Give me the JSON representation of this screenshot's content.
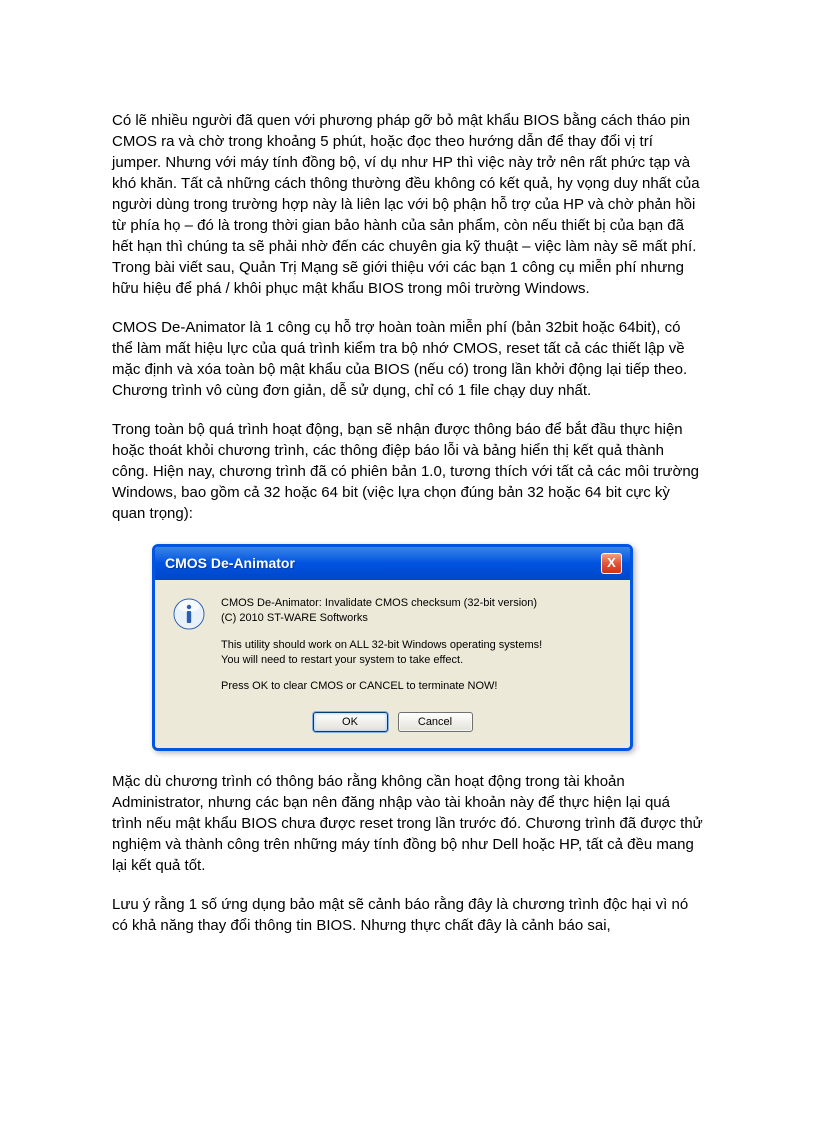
{
  "document": {
    "p1": "Có lẽ nhiều người đã quen với phương pháp gỡ bỏ mật khẩu BIOS bằng cách tháo pin CMOS ra và chờ trong khoảng 5 phút, hoặc đọc theo hướng dẫn để thay đổi vị trí jumper. Nhưng với máy tính đồng bộ, ví dụ như HP thì việc này trở nên rất phức tạp và khó khăn. Tất cả những cách thông thường đều không có kết quả, hy vọng duy nhất của người dùng trong trường hợp này là liên lạc với bộ phận hỗ trợ của HP và chờ phản hồi từ phía họ – đó là trong thời gian bảo hành của sản phẩm, còn nếu thiết bị của bạn đã hết hạn thì chúng ta sẽ phải nhờ đến các chuyên gia kỹ thuật – việc làm này sẽ mất phí. Trong bài viết sau, Quản Trị Mạng sẽ giới thiệu với các bạn 1 công cụ miễn phí nhưng hữu hiệu để phá / khôi phục mật khẩu BIOS trong môi trường Windows.",
    "p2": "CMOS De-Animator là 1 công cụ hỗ trợ hoàn toàn miễn phí (bản 32bit hoặc 64bit), có thể làm mất hiệu lực của quá trình kiểm tra bộ nhớ CMOS, reset tất cả các thiết lập về mặc định và xóa toàn bộ mật khẩu của BIOS (nếu có) trong lần khởi động lại tiếp theo. Chương trình vô cùng đơn giản, dễ sử dụng, chỉ có 1 file chạy duy nhất.",
    "p3": "Trong toàn bộ quá trình hoạt động, bạn sẽ nhận được thông báo để bắt đầu thực hiện hoặc thoát khỏi chương trình, các thông điệp báo lỗi và bảng hiển thị kết quả thành công. Hiện nay, chương trình đã có phiên bản 1.0, tương thích với tất cả các môi trường Windows, bao gồm cả 32 hoặc 64 bit (việc lựa chọn đúng bản 32 hoặc 64 bit cực kỳ quan trọng):",
    "p4": "Mặc dù chương trình có thông báo rằng không cần hoạt động trong tài khoản Administrator, nhưng các bạn nên đăng nhập vào tài khoản này để thực hiện lại quá trình nếu mật khẩu BIOS chưa được reset trong lần trước đó. Chương trình đã được thử nghiệm và thành công trên những máy tính đồng bộ như Dell hoặc HP, tất cả đều mang lại kết quả tốt.",
    "p5": "Lưu ý rằng 1 số ứng dụng bảo mật sẽ cảnh báo rằng đây là chương trình độc hại vì nó có khả năng thay đổi thông tin BIOS. Nhưng thực chất đây là cảnh báo sai,"
  },
  "dialog": {
    "title": "CMOS De-Animator",
    "close_label": "X",
    "line1": "CMOS De-Animator: Invalidate CMOS checksum (32-bit version)",
    "line2": "(C) 2010 ST-WARE Softworks",
    "line3": "This utility should work on ALL 32-bit Windows operating systems!",
    "line4": "You will need to restart your system to take effect.",
    "line5": "Press OK to clear CMOS or CANCEL to terminate NOW!",
    "ok_label": "OK",
    "cancel_label": "Cancel"
  }
}
